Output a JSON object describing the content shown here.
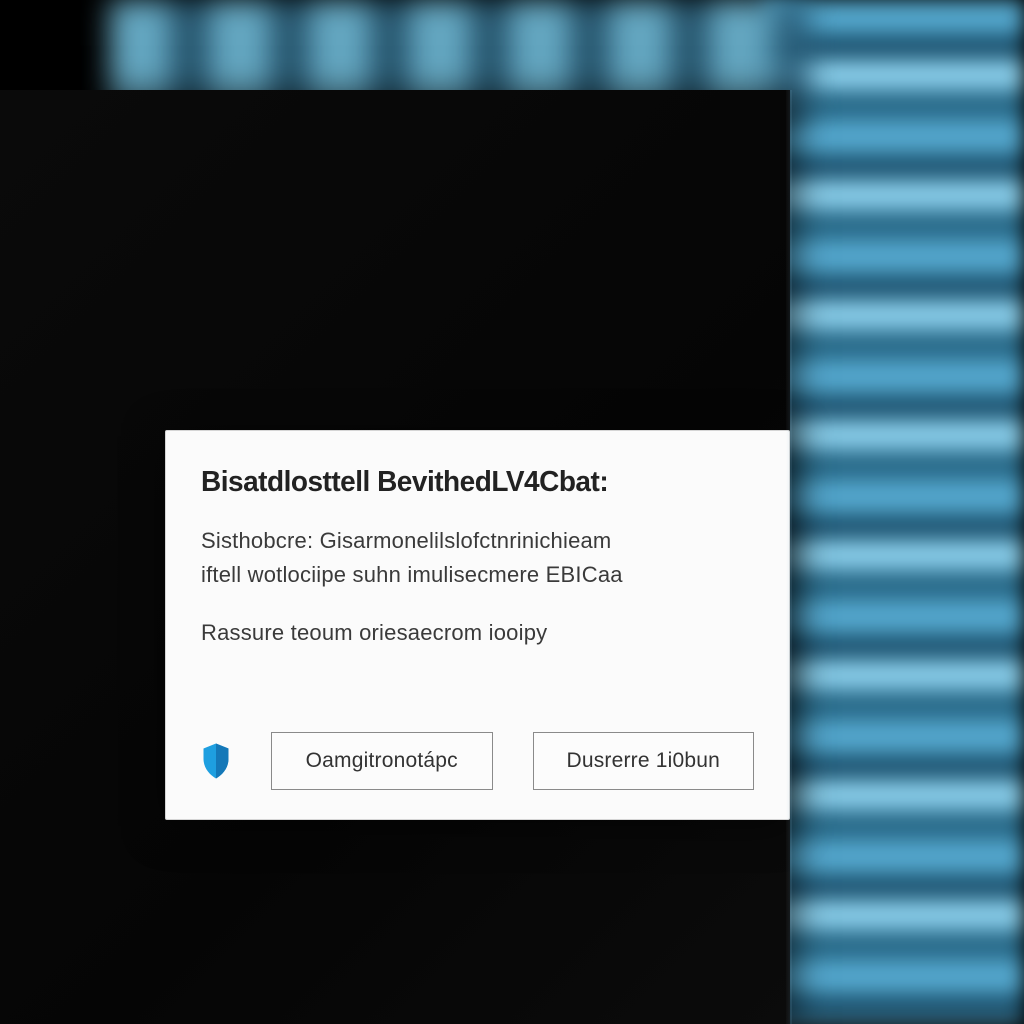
{
  "dialog": {
    "title": "Bisatdlosttell BevithedLV4Cbat:",
    "body_line1": "Sisthobcre: Gisarmonelilslofctnrinichieam",
    "body_line2": "iftell wotlociipe suhn imulisecmere EBICaa",
    "sub": "Rassure teoum oriesaecrom iooipy",
    "buttons": {
      "primary": "Oamgitronotápc",
      "secondary": "Dusrerre 1i0bun"
    },
    "icon": "shield-icon",
    "accent_color": "#1e9fe0"
  }
}
